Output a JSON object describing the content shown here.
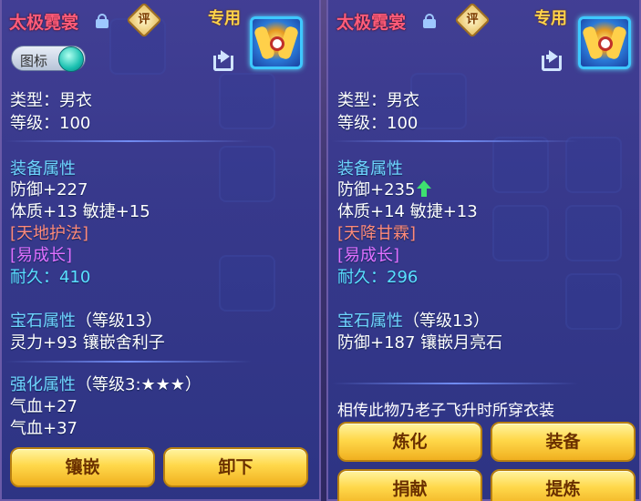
{
  "left": {
    "title": "太极霓裳",
    "rate_label": "评",
    "exclusive_label": "专用",
    "toggle_label": "图标",
    "type": "类型：男衣",
    "level": "等级：100",
    "equip_header": "装备属性",
    "defense": "防御+227",
    "stats": "体质+13 敏捷+15",
    "special1": "[天地护法]",
    "special2": "[易成长]",
    "durability_label": "耐久：",
    "durability_value": "410",
    "gem_header": "宝石属性",
    "gem_level": "（等级13）",
    "gem_line": "灵力+93 镶嵌舍利子",
    "enhance_header": "强化属性",
    "enhance_level": "（等级3:★★★）",
    "enhance_line1": "气血+27",
    "enhance_line2": "气血+37",
    "btn_inlay": "镶嵌",
    "btn_unequip": "卸下"
  },
  "right": {
    "title": "太极霓裳",
    "rate_label": "评",
    "exclusive_label": "专用",
    "type": "类型：男衣",
    "level": "等级：100",
    "equip_header": "装备属性",
    "defense": "防御+235",
    "stats": "体质+14 敏捷+13",
    "special1": "[天降甘霖]",
    "special2": "[易成长]",
    "durability_label": "耐久：",
    "durability_value": "296",
    "gem_header": "宝石属性",
    "gem_level": "（等级13）",
    "gem_line": "防御+187 镶嵌月亮石",
    "legend": "相传此物乃老子飞升时所穿衣装",
    "btn_refine": "炼化",
    "btn_equip": "装备",
    "btn_donate": "捐献",
    "btn_extract": "提炼"
  },
  "colors": {
    "title": "#ff5c7a",
    "section": "#6fd6ff",
    "special_red": "#ff8a7a",
    "special_purple": "#e070ff",
    "durability": "#5ae0ff",
    "button": "#ffd84a"
  },
  "icons": [
    "lock-icon",
    "rate-icon",
    "emblem-icon",
    "share-icon",
    "up-arrow-icon"
  ]
}
